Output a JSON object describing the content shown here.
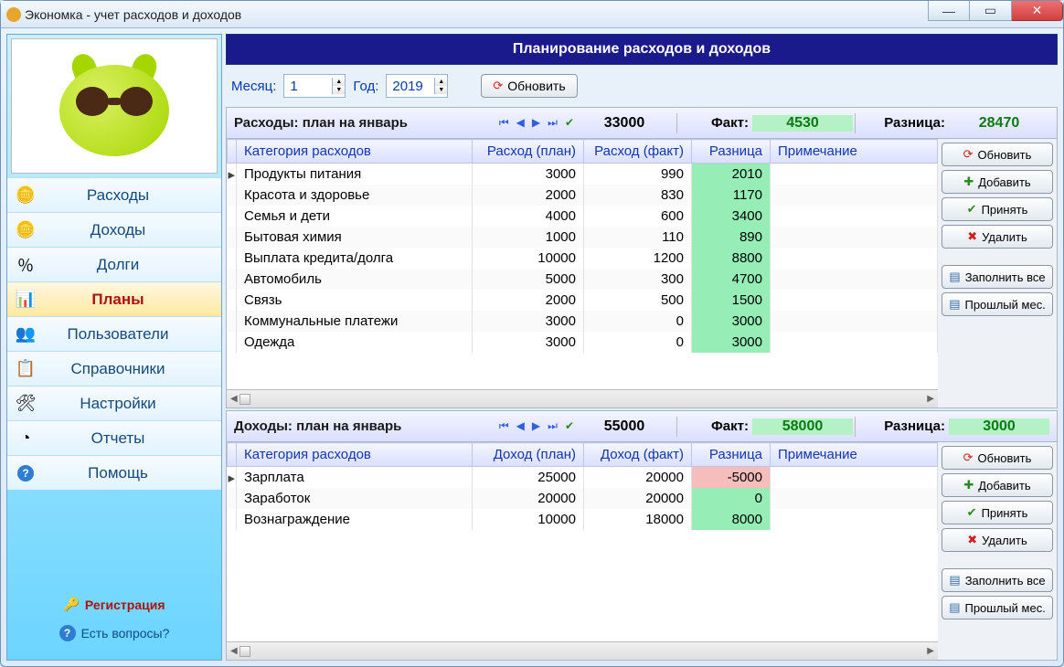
{
  "window": {
    "title": "Экономка - учет расходов и доходов"
  },
  "sidebar": {
    "items": [
      {
        "label": "Расходы"
      },
      {
        "label": "Доходы"
      },
      {
        "label": "Долги"
      },
      {
        "label": "Планы"
      },
      {
        "label": "Пользователи"
      },
      {
        "label": "Справочники"
      },
      {
        "label": "Настройки"
      },
      {
        "label": "Отчеты"
      },
      {
        "label": "Помощь"
      }
    ],
    "registration": "Регистрация",
    "questions": "Есть вопросы?"
  },
  "header": "Планирование расходов и доходов",
  "controls": {
    "month_label": "Месяц:",
    "month_value": "1",
    "year_label": "Год:",
    "year_value": "2019",
    "refresh_label": "Обновить"
  },
  "expenses": {
    "title": "Расходы: план на январь",
    "total_plan": "33000",
    "fact_label": "Факт:",
    "fact_value": "4530",
    "diff_label": "Разница:",
    "diff_value": "28470",
    "headers": {
      "category": "Категория расходов",
      "plan": "Расход (план)",
      "fact": "Расход (факт)",
      "diff": "Разница",
      "note": "Примечание"
    },
    "rows": [
      {
        "category": "Продукты питания",
        "plan": "3000",
        "fact": "990",
        "diff": "2010"
      },
      {
        "category": "Красота и здоровье",
        "plan": "2000",
        "fact": "830",
        "diff": "1170"
      },
      {
        "category": "Семья и дети",
        "plan": "4000",
        "fact": "600",
        "diff": "3400"
      },
      {
        "category": "Бытовая химия",
        "plan": "1000",
        "fact": "110",
        "diff": "890"
      },
      {
        "category": "Выплата кредита/долга",
        "plan": "10000",
        "fact": "1200",
        "diff": "8800"
      },
      {
        "category": "Автомобиль",
        "plan": "5000",
        "fact": "300",
        "diff": "4700"
      },
      {
        "category": "Связь",
        "plan": "2000",
        "fact": "500",
        "diff": "1500"
      },
      {
        "category": "Коммунальные платежи",
        "plan": "3000",
        "fact": "0",
        "diff": "3000"
      },
      {
        "category": "Одежда",
        "plan": "3000",
        "fact": "0",
        "diff": "3000"
      }
    ]
  },
  "incomes": {
    "title": "Доходы: план на январь",
    "total_plan": "55000",
    "fact_label": "Факт:",
    "fact_value": "58000",
    "diff_label": "Разница:",
    "diff_value": "3000",
    "headers": {
      "category": "Категория расходов",
      "plan": "Доход (план)",
      "fact": "Доход (факт)",
      "diff": "Разница",
      "note": "Примечание"
    },
    "rows": [
      {
        "category": "Зарплата",
        "plan": "25000",
        "fact": "20000",
        "diff": "-5000",
        "neg": true
      },
      {
        "category": "Заработок",
        "plan": "20000",
        "fact": "20000",
        "diff": "0"
      },
      {
        "category": "Вознаграждение",
        "plan": "10000",
        "fact": "18000",
        "diff": "8000"
      }
    ]
  },
  "buttons": {
    "refresh": "Обновить",
    "add": "Добавить",
    "accept": "Принять",
    "delete": "Удалить",
    "fill_all": "Заполнить все",
    "prev_month": "Прошлый мес."
  }
}
